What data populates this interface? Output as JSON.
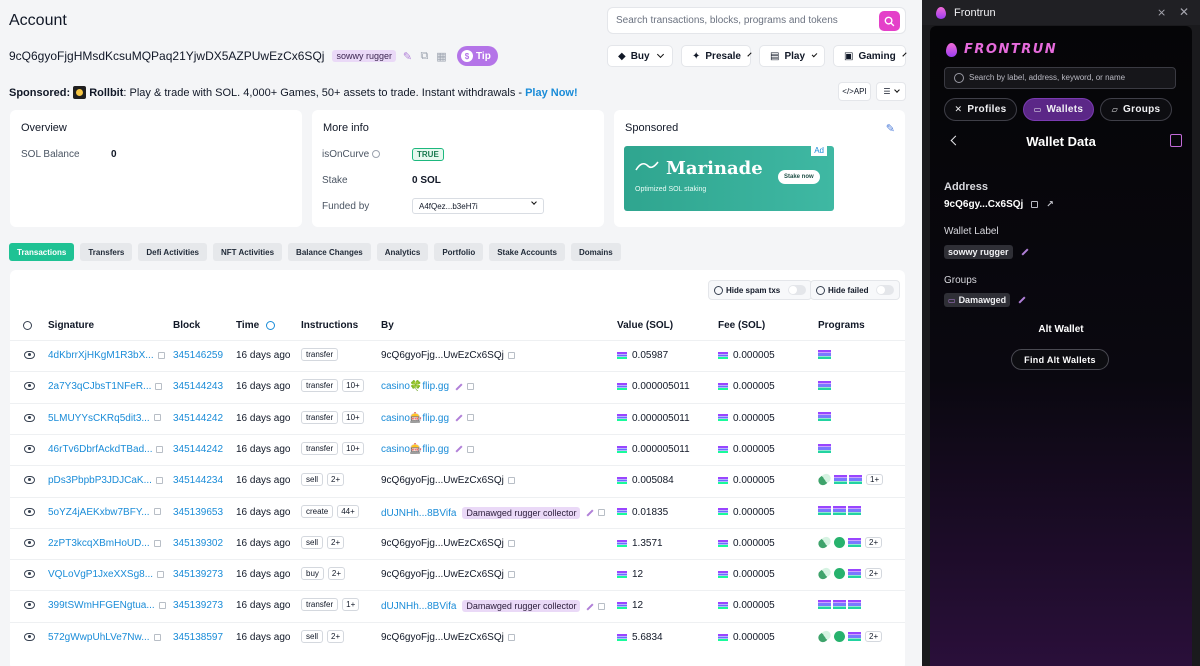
{
  "header": {
    "title": "Account",
    "search_placeholder": "Search transactions, blocks, programs and tokens"
  },
  "account": {
    "address": "9cQ6gyoFjgHMsdKcsuMQPaq21YjwDX5AZPUwEzCx6SQj",
    "label": "sowwy rugger",
    "tip_label": "Tip"
  },
  "top_menus": [
    "Buy",
    "Presale",
    "Play",
    "Gaming"
  ],
  "sponsor_bar": {
    "prefix": "Sponsored:",
    "brand": "Rollbit",
    "text": ": Play & trade with SOL. 4,000+ Games, 50+ assets to trade. Instant withdrawals -",
    "cta": "Play Now!",
    "api_label": "</>API"
  },
  "overview": {
    "title": "Overview",
    "sol_balance_label": "SOL Balance",
    "sol_balance_value": "0"
  },
  "more_info": {
    "title": "More info",
    "is_on_curve_label": "isOnCurve",
    "is_on_curve_value": "TRUE",
    "stake_label": "Stake",
    "stake_value": "0 SOL",
    "funded_by_label": "Funded by",
    "funded_by_value": "A4fQez...b3eH7i"
  },
  "sponsored_card": {
    "title": "Sponsored",
    "ad_brand": "Marinade",
    "ad_tagline": "Optimized SOL staking",
    "ad_cta": "Stake now",
    "ad_tag": "Ad"
  },
  "tabs": [
    "Transactions",
    "Transfers",
    "Defi Activities",
    "NFT Activities",
    "Balance Changes",
    "Analytics",
    "Portfolio",
    "Stake Accounts",
    "Domains"
  ],
  "filters": {
    "hide_spam": "Hide spam txs",
    "hide_failed": "Hide failed"
  },
  "table": {
    "headers": [
      "Signature",
      "Block",
      "Time",
      "Instructions",
      "By",
      "Value (SOL)",
      "Fee (SOL)",
      "Programs"
    ],
    "rows": [
      {
        "sig": "4dKbrrXjHKgM1R3bX...",
        "block": "345146259",
        "time": "16 days ago",
        "instr": "transfer",
        "count": "",
        "by": "9cQ6gyoFjg...UwEzCx6SQj",
        "by_link": false,
        "by_badge": "",
        "value": "0.05987",
        "fee": "0.000005",
        "prog": "sol",
        "prog_more": ""
      },
      {
        "sig": "2a7Y3qCJbsT1NFeR...",
        "block": "345144243",
        "time": "16 days ago",
        "instr": "transfer",
        "count": "10+",
        "by": "casino🍀flip.gg",
        "by_link": true,
        "by_badge": "",
        "value": "0.000005011",
        "fee": "0.000005",
        "prog": "sol",
        "prog_more": ""
      },
      {
        "sig": "5LMUYYsCKRq5dit3...",
        "block": "345144242",
        "time": "16 days ago",
        "instr": "transfer",
        "count": "10+",
        "by": "casino🎰flip.gg",
        "by_link": true,
        "by_badge": "",
        "value": "0.000005011",
        "fee": "0.000005",
        "prog": "sol",
        "prog_more": ""
      },
      {
        "sig": "46rTv6DbrfAckdTBad...",
        "block": "345144242",
        "time": "16 days ago",
        "instr": "transfer",
        "count": "10+",
        "by": "casino🎰flip.gg",
        "by_link": true,
        "by_badge": "",
        "value": "0.000005011",
        "fee": "0.000005",
        "prog": "sol",
        "prog_more": ""
      },
      {
        "sig": "pDs3PbpbP3JDJCaK...",
        "block": "345144234",
        "time": "16 days ago",
        "instr": "sell",
        "count": "2+",
        "by": "9cQ6gyoFjg...UwEzCx6SQj",
        "by_link": false,
        "by_badge": "",
        "value": "0.005084",
        "fee": "0.000005",
        "prog": "pill-sol-sol",
        "prog_more": "1+"
      },
      {
        "sig": "5oYZ4jAEKxbw7BFY...",
        "block": "345139653",
        "time": "16 days ago",
        "instr": "create",
        "count": "44+",
        "by": "dUJNHh...8BVifa",
        "by_link": true,
        "by_badge": "Damawged rugger collector",
        "value": "0.01835",
        "fee": "0.000005",
        "prog": "sol-sol-sol",
        "prog_more": ""
      },
      {
        "sig": "2zPT3kcqXBmHoUD...",
        "block": "345139302",
        "time": "16 days ago",
        "instr": "sell",
        "count": "2+",
        "by": "9cQ6gyoFjg...UwEzCx6SQj",
        "by_link": false,
        "by_badge": "",
        "value": "1.3571",
        "fee": "0.000005",
        "prog": "pill-dot-sol",
        "prog_more": "2+"
      },
      {
        "sig": "VQLoVgP1JxeXXSg8...",
        "block": "345139273",
        "time": "16 days ago",
        "instr": "buy",
        "count": "2+",
        "by": "9cQ6gyoFjg...UwEzCx6SQj",
        "by_link": false,
        "by_badge": "",
        "value": "12",
        "fee": "0.000005",
        "prog": "pill-dot-sol",
        "prog_more": "2+"
      },
      {
        "sig": "399tSWmHFGENgtua...",
        "block": "345139273",
        "time": "16 days ago",
        "instr": "transfer",
        "count": "1+",
        "by": "dUJNHh...8BVifa",
        "by_link": true,
        "by_badge": "Damawged rugger collector",
        "value": "12",
        "fee": "0.000005",
        "prog": "sol-sol-sol",
        "prog_more": ""
      },
      {
        "sig": "572gWwpUhLVe7Nw...",
        "block": "345138597",
        "time": "16 days ago",
        "instr": "sell",
        "count": "2+",
        "by": "9cQ6gyoFjg...UwEzCx6SQj",
        "by_link": false,
        "by_badge": "",
        "value": "5.6834",
        "fee": "0.000005",
        "prog": "pill-dot-sol",
        "prog_more": "2+"
      }
    ]
  },
  "panel": {
    "window_title": "Frontrun",
    "brand": "FRONTRUN",
    "search_placeholder": "Search by label, address, keyword, or name",
    "tabs": [
      "Profiles",
      "Wallets",
      "Groups"
    ],
    "section_title": "Wallet Data",
    "address_label": "Address",
    "address_value": "9cQ6gy...Cx6SQj",
    "wallet_label_label": "Wallet Label",
    "wallet_label_value": "sowwy rugger",
    "groups_label": "Groups",
    "groups_value": "Damawged",
    "alt_wallet_title": "Alt Wallet",
    "find_alt_button": "Find Alt Wallets"
  },
  "colors": {
    "accent_green": "#1fc294",
    "accent_pink": "#e440c9",
    "link_blue": "#1a8cd8",
    "panel_purple": "#5b2787"
  }
}
